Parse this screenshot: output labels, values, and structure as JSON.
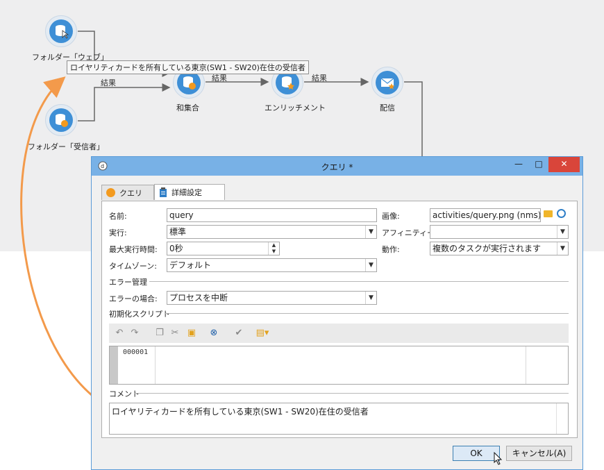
{
  "workflow": {
    "nodes": [
      {
        "label": "フォルダー「ウェブ」",
        "icon": "database-pointer-icon"
      },
      {
        "label": "フォルダー「受信者」",
        "icon": "database-orange-icon"
      },
      {
        "label": "和集合",
        "icon": "database-orange-icon"
      },
      {
        "label": "エンリッチメント",
        "icon": "database-star-icon"
      },
      {
        "label": "配信",
        "icon": "envelope-star-icon"
      }
    ],
    "edge_labels": [
      "結果",
      "結果",
      "結果"
    ],
    "tooltip": "ロイヤリティカードを所有している東京(SW1 - SW20)在住の受信者"
  },
  "dialog": {
    "title": "クエリ *",
    "window_controls": {
      "minimize": "—",
      "maximize": "□",
      "close": "✕"
    },
    "tabs": [
      {
        "label": "クエリ",
        "icon": "circle-orange-icon"
      },
      {
        "label": "詳細設定",
        "icon": "clipboard-icon"
      }
    ],
    "fields": {
      "name_label": "名前:",
      "name_value": "query",
      "image_label": "画像:",
      "image_value": "activities/query.png (nms)",
      "exec_label": "実行:",
      "exec_value": "標準",
      "affinity_label": "アフィニティー:",
      "affinity_value": "",
      "max_time_label": "最大実行時間:",
      "max_time_value": "0秒",
      "action_label": "動作:",
      "action_value": "複数のタスクが実行されます",
      "timezone_label": "タイムゾーン:",
      "timezone_value": "デフォルト"
    },
    "error_section": "エラー管理",
    "error_label": "エラーの場合:",
    "error_value": "プロセスを中断",
    "script_section": "初期化スクリプト",
    "line_number": "000001",
    "comment_section": "コメント",
    "comment_value": "ロイヤリティカードを所有している東京(SW1 - SW20)在住の受信者",
    "ok_label": "OK",
    "cancel_label": "キャンセル(A)"
  },
  "colors": {
    "accent": "#3e8fd6",
    "titlebar": "#78b1e6",
    "arrow": "#f39a4b",
    "close": "#d9453a"
  }
}
